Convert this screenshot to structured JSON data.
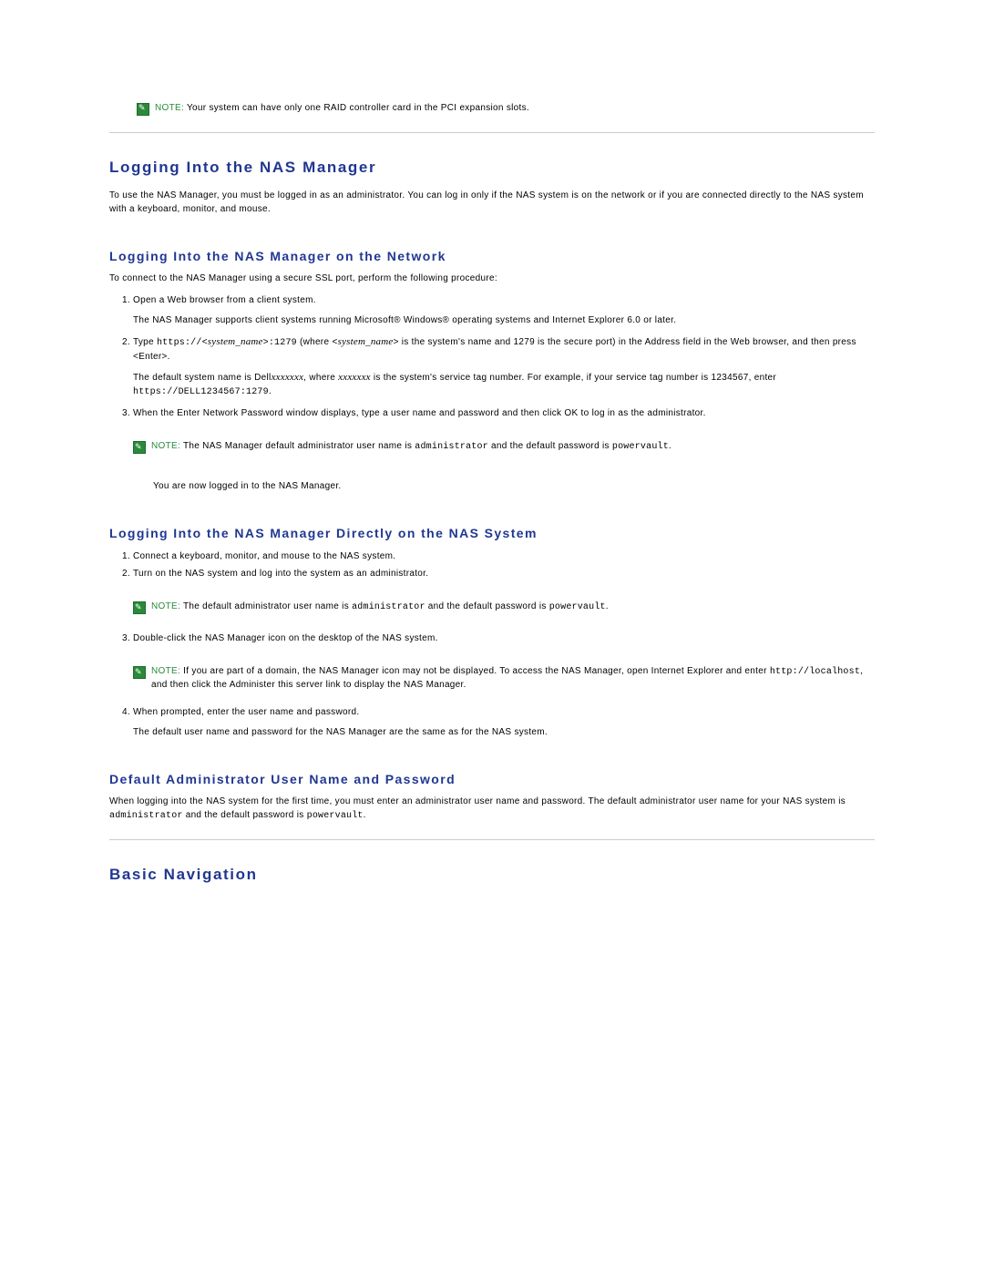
{
  "topNote": {
    "label": "NOTE:",
    "text": "Your system can have only one RAID controller card in the PCI expansion slots."
  },
  "h1a": "Logging Into the NAS Manager",
  "introA": "To use the NAS Manager, you must be logged in as an administrator. You can log in only if the NAS system is on the network or if you are connected directly to the NAS system with a keyboard, monitor, and mouse.",
  "h2a": "Logging Into the NAS Manager on the Network",
  "connectLine": "To connect to the NAS Manager using a secure SSL port, perform the following procedure:",
  "netStep1": "Open a Web browser from a client system.",
  "netStep1b": "The NAS Manager supports client systems running Microsoft® Windows® operating systems and Internet Explorer 6.0 or later.",
  "netStep2_pre": "Type ",
  "netStep2_code1a": "https://<",
  "netStep2_sys": "system_name",
  "netStep2_code1b": ">:1279",
  "netStep2_where": " (where ",
  "netStep2_code2a": "<",
  "netStep2_code2b": ">",
  "netStep2_rest": " is the system's name and 1279 is the secure port) in the Address field in the Web browser, and then press <Enter>.",
  "netStep2b_pre": "The default system name is Dell",
  "netStep2b_x1": "xxxxxxx",
  "netStep2b_mid": ", where ",
  "netStep2b_x2": "xxxxxxx",
  "netStep2b_rest": " is the system's service tag number. For example, if your service tag number is 1234567, enter ",
  "netStep2b_code": "https://DELL1234567:1279",
  "netStep2b_dot": ".",
  "netStep3": "When the Enter Network Password window displays, type a user name and password and then click OK to log in as the administrator.",
  "netNote": {
    "label": "NOTE:",
    "pre": "The NAS Manager default administrator user name is ",
    "code1": "administrator",
    "mid": " and the default password is ",
    "code2": "powervault",
    "dot": "."
  },
  "netLogged": "You are now logged in to the NAS Manager.",
  "h2b": "Logging Into the NAS Manager Directly on the NAS System",
  "dirStep1": "Connect a keyboard, monitor, and mouse to the NAS system.",
  "dirStep2": "Turn on the NAS system and log into the system as an administrator.",
  "dirNote1": {
    "label": "NOTE:",
    "pre": "The default administrator user name is ",
    "code1": "administrator",
    "mid": " and the default password is ",
    "code2": "powervault",
    "dot": "."
  },
  "dirStep3": "Double-click the NAS Manager icon on the desktop of the NAS system.",
  "dirNote2": {
    "label": "NOTE:",
    "pre": "If you are part of a domain, the NAS Manager icon may not be displayed. To access the NAS Manager, open Internet Explorer and enter ",
    "code1": "http://localhost",
    "rest": ", and then click the Administer this server link to display the NAS Manager."
  },
  "dirStep4": "When prompted, enter the user name and password.",
  "dirAfter": "The default user name and password for the NAS Manager are the same as for the NAS system.",
  "h2c": "Default Administrator User Name and Password",
  "defPara_pre": "When logging into the NAS system for the first time, you must enter an administrator user name and password. The default administrator user name for your NAS system is ",
  "defPara_code1": "administrator",
  "defPara_mid": " and the default password is ",
  "defPara_code2": "powervault",
  "defPara_dot": ".",
  "h1b": "Basic Navigation"
}
